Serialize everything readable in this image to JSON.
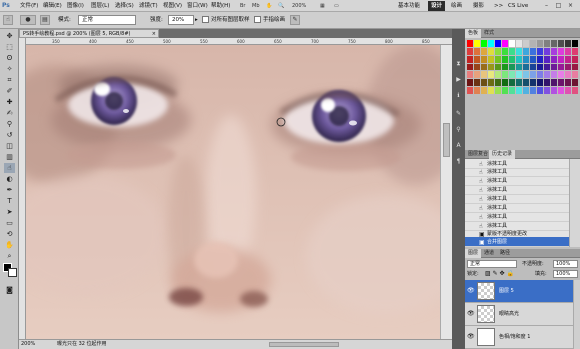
{
  "menubar": {
    "logo": "Ps",
    "items": [
      "文件(F)",
      "编辑(E)",
      "图像(I)",
      "图层(L)",
      "选择(S)",
      "滤镜(T)",
      "视图(V)",
      "窗口(W)",
      "帮助(H)"
    ],
    "zoom": "200%",
    "workspaces": [
      "基本功能",
      "设计",
      "绘画",
      "摄影"
    ],
    "more": ">>",
    "cs_live": "CS Live"
  },
  "options": {
    "mode_label": "模式:",
    "mode_value": "正常",
    "strength_label": "强度:",
    "strength_value": "20%",
    "sample_all_label": "对所有图层取样",
    "finger_label": "手指绘画"
  },
  "document": {
    "tab_title": "PS转手绘教程.psd @ 200% (图层 5, RGB/8#)",
    "tab_close": "×",
    "ruler_ticks": [
      "350",
      "400",
      "450",
      "500",
      "550",
      "600",
      "650",
      "700",
      "750",
      "800",
      "850"
    ],
    "status_zoom": "200%",
    "status_info": "曝光只在 32 位起作用"
  },
  "swatches_panel": {
    "tabs": [
      "色板",
      "样式"
    ]
  },
  "history_panel": {
    "tabs": [
      "图层复合",
      "历史记录"
    ],
    "items": [
      "涂抹工具",
      "涂抹工具",
      "涂抹工具",
      "涂抹工具",
      "涂抹工具",
      "涂抹工具",
      "涂抹工具",
      "涂抹工具",
      "蒙版不透明度更改",
      "合并图层"
    ]
  },
  "layers_panel": {
    "tabs": [
      "图层",
      "通道",
      "路径"
    ],
    "blend_mode": "正常",
    "opacity_label": "不透明度:",
    "opacity_value": "100%",
    "lock_label": "锁定:",
    "fill_label": "填充:",
    "fill_value": "100%",
    "layers": [
      "图层 5",
      "眼睛高光",
      "色相/饱和度 1"
    ]
  },
  "colors": {
    "accent": "#3a6ec6",
    "active_workspace": "#2b2b2b"
  }
}
